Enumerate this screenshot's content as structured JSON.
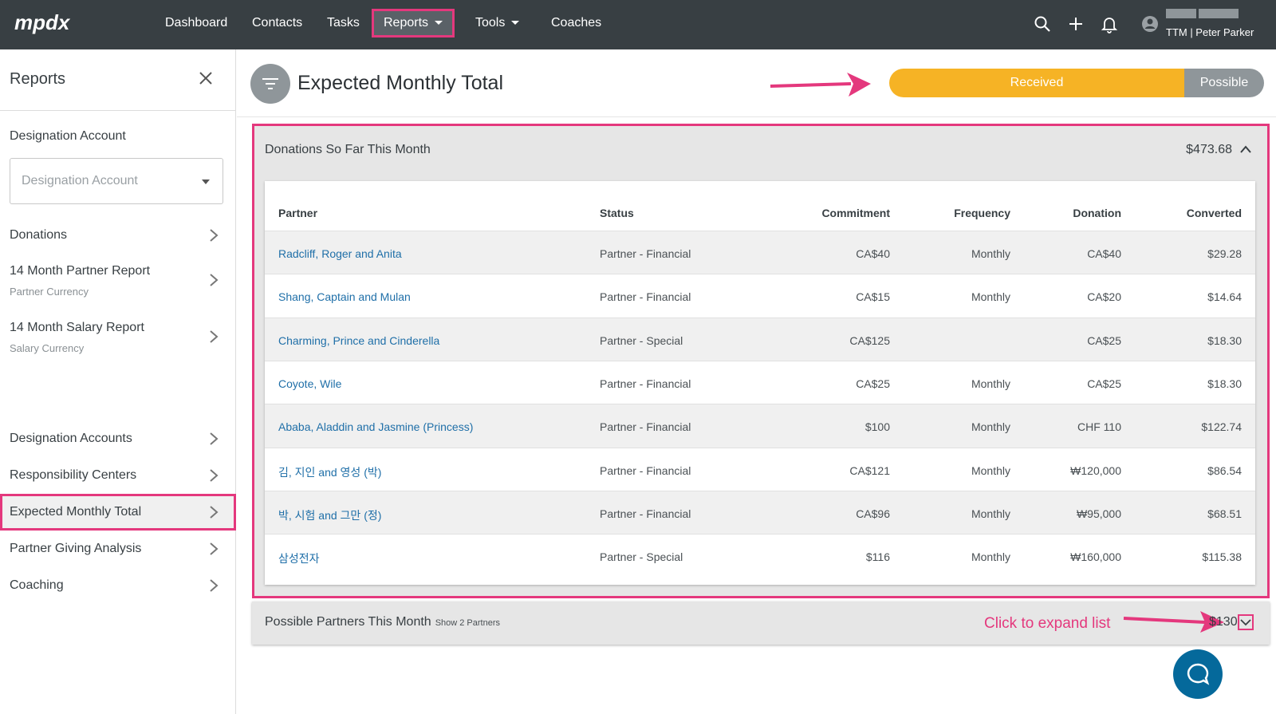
{
  "app": {
    "logo_text": "mpdx",
    "nav": {
      "dashboard": "Dashboard",
      "contacts": "Contacts",
      "tasks": "Tasks",
      "reports": "Reports",
      "tools": "Tools",
      "coaches": "Coaches"
    },
    "user": {
      "name": "TTM | Peter Parker"
    }
  },
  "sidebar": {
    "title": "Reports",
    "designation_label": "Designation Account",
    "designation_placeholder": "Designation Account",
    "items": [
      {
        "label": "Donations",
        "sub": ""
      },
      {
        "label": "14 Month Partner Report",
        "sub": "Partner Currency"
      },
      {
        "label": "14 Month Salary Report",
        "sub": "Salary Currency"
      },
      {
        "label": "Designation Accounts",
        "sub": ""
      },
      {
        "label": "Responsibility Centers",
        "sub": ""
      },
      {
        "label": "Expected Monthly Total",
        "sub": "",
        "active": true
      },
      {
        "label": "Partner Giving Analysis",
        "sub": ""
      },
      {
        "label": "Coaching",
        "sub": ""
      }
    ]
  },
  "main": {
    "title": "Expected Monthly Total",
    "toggle": {
      "received": "Received",
      "possible": "Possible",
      "selected": "Received"
    },
    "donations_panel": {
      "title": "Donations So Far This Month",
      "amount": "$473.68",
      "columns": [
        "Partner",
        "Status",
        "Commitment",
        "Frequency",
        "Donation",
        "Converted"
      ],
      "rows": [
        {
          "partner": "Radcliff, Roger and Anita",
          "status": "Partner - Financial",
          "commitment": "CA$40",
          "frequency": "Monthly",
          "donation": "CA$40",
          "converted": "$29.28"
        },
        {
          "partner": "Shang, Captain and Mulan",
          "status": "Partner - Financial",
          "commitment": "CA$15",
          "frequency": "Monthly",
          "donation": "CA$20",
          "converted": "$14.64"
        },
        {
          "partner": "Charming, Prince and Cinderella",
          "status": "Partner - Special",
          "commitment": "CA$125",
          "frequency": "",
          "donation": "CA$25",
          "converted": "$18.30"
        },
        {
          "partner": "Coyote, Wile",
          "status": "Partner - Financial",
          "commitment": "CA$25",
          "frequency": "Monthly",
          "donation": "CA$25",
          "converted": "$18.30"
        },
        {
          "partner": "Ababa, Aladdin and Jasmine (Princess)",
          "status": "Partner - Financial",
          "commitment": "$100",
          "frequency": "Monthly",
          "donation": "CHF 110",
          "converted": "$122.74"
        },
        {
          "partner": "김, 지인 and 영성 (박)",
          "status": "Partner - Financial",
          "commitment": "CA$121",
          "frequency": "Monthly",
          "donation": "₩120,000",
          "converted": "$86.54"
        },
        {
          "partner": "박, 시험 and 그만 (정)",
          "status": "Partner - Financial",
          "commitment": "CA$96",
          "frequency": "Monthly",
          "donation": "₩95,000",
          "converted": "$68.51"
        },
        {
          "partner": "삼성전자",
          "status": "Partner - Special",
          "commitment": "$116",
          "frequency": "Monthly",
          "donation": "₩160,000",
          "converted": "$115.38"
        }
      ]
    },
    "possible_panel": {
      "title": "Possible Partners This Month",
      "sub": "Show 2 Partners",
      "amount": "$130"
    },
    "annotation": "Click to expand list"
  },
  "colors": {
    "topbar": "#383f43",
    "accent_pink": "#e4387d",
    "received": "#f6b325",
    "possible": "#8f969a",
    "link": "#1f6fa8",
    "help": "#05699b"
  },
  "icons": [
    "filter-icon",
    "search-icon",
    "plus-icon",
    "bell-icon",
    "user-icon",
    "close-icon",
    "chevron-right-icon",
    "chevron-up-icon",
    "chevron-down-icon",
    "chat-icon"
  ]
}
